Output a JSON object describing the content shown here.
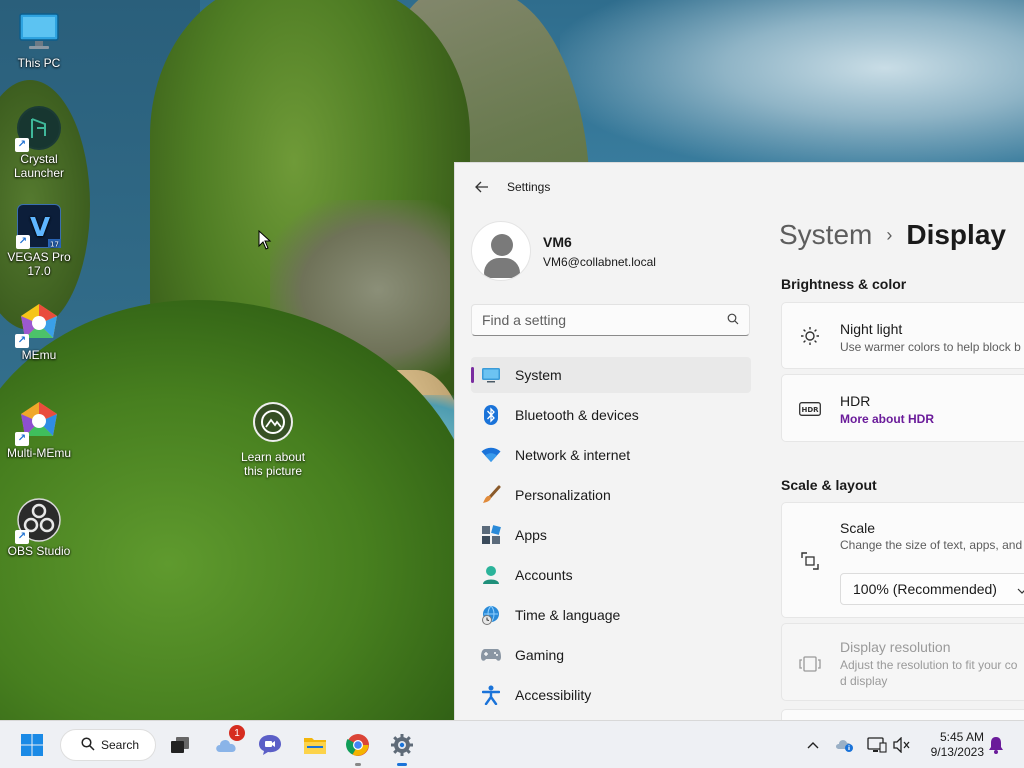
{
  "desktop": {
    "icons": [
      {
        "label": "This PC"
      },
      {
        "label": "Crystal Launcher"
      },
      {
        "label": "VEGAS Pro 17.0"
      },
      {
        "label": "MEmu"
      },
      {
        "label": "Multi-MEmu"
      },
      {
        "label": "OBS Studio"
      }
    ],
    "learn_label": "Learn about this picture"
  },
  "settings": {
    "title": "Settings",
    "user": {
      "name": "VM6",
      "email": "VM6@collabnet.local"
    },
    "search_placeholder": "Find a setting",
    "nav": [
      {
        "label": "System",
        "icon": "system-icon",
        "active": true
      },
      {
        "label": "Bluetooth & devices",
        "icon": "bluetooth-icon"
      },
      {
        "label": "Network & internet",
        "icon": "wifi-icon"
      },
      {
        "label": "Personalization",
        "icon": "brush-icon"
      },
      {
        "label": "Apps",
        "icon": "apps-icon"
      },
      {
        "label": "Accounts",
        "icon": "person-icon"
      },
      {
        "label": "Time & language",
        "icon": "globe-clock-icon"
      },
      {
        "label": "Gaming",
        "icon": "gamepad-icon"
      },
      {
        "label": "Accessibility",
        "icon": "accessibility-icon"
      }
    ],
    "breadcrumb": {
      "parent": "System",
      "current": "Display"
    },
    "brightness_section": "Brightness & color",
    "night_light": {
      "title": "Night light",
      "subtitle": "Use warmer colors to help block b"
    },
    "hdr": {
      "title": "HDR",
      "link": "More about HDR",
      "icon_text": "HDR"
    },
    "scale_section": "Scale & layout",
    "scale": {
      "title": "Scale",
      "subtitle": "Change the size of text, apps, and",
      "value": "100% (Recommended)"
    },
    "resolution": {
      "title": "Display resolution",
      "subtitle_line1": "Adjust the resolution to fit your co",
      "subtitle_line2": "d display"
    },
    "accent_color": "#6a1b9a"
  },
  "taskbar": {
    "search_label": "Search",
    "chat_badge": "1",
    "time": "5:45 AM",
    "date": "9/13/2023"
  }
}
